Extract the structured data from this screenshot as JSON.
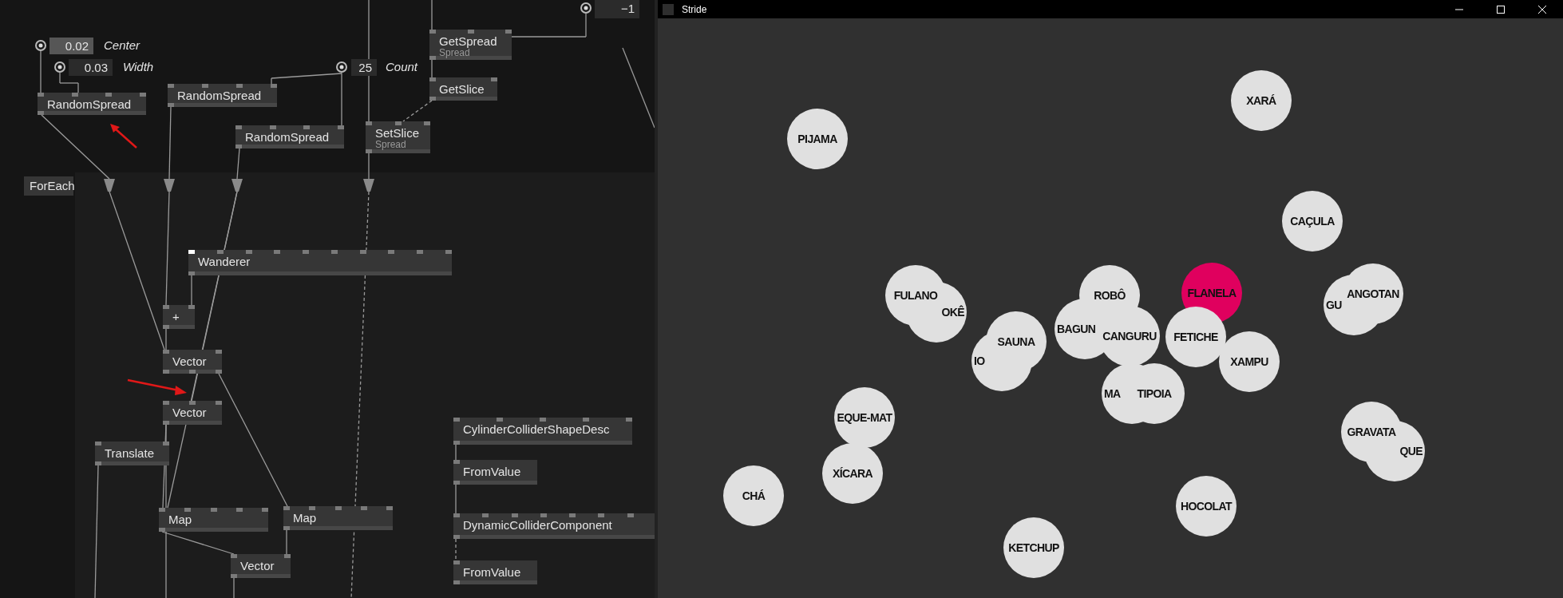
{
  "io_boxes": [
    {
      "value": "0.02",
      "label": "Center",
      "selected": true
    },
    {
      "value": "0.03",
      "label": "Width",
      "selected": false
    },
    {
      "value": "25",
      "label": "Count",
      "selected": false
    },
    {
      "value": "−1",
      "selected": false
    }
  ],
  "nodes": [
    {
      "title": "RandomSpread"
    },
    {
      "title": "RandomSpread"
    },
    {
      "title": "RandomSpread"
    },
    {
      "title": "GetSpread",
      "subtitle": "Spread"
    },
    {
      "title": "GetSlice"
    },
    {
      "title": "SetSlice",
      "subtitle": "Spread"
    },
    {
      "title": "ForEach"
    },
    {
      "title": "Wanderer"
    },
    {
      "title": "+"
    },
    {
      "title": "Vector"
    },
    {
      "title": "Vector"
    },
    {
      "title": "Translate"
    },
    {
      "title": "Map"
    },
    {
      "title": "Map"
    },
    {
      "title": "Vector"
    },
    {
      "title": "CylinderColliderShapeDesc"
    },
    {
      "title": "FromValue"
    },
    {
      "title": "DynamicColliderComponent"
    },
    {
      "title": "FromValue"
    }
  ],
  "window": {
    "title": "Stride"
  },
  "balls": [
    {
      "label": "XARÁ",
      "color": "#e0e0e0"
    },
    {
      "label": "PIJAMA",
      "color": "#e0e0e0"
    },
    {
      "label": "CAÇULA",
      "color": "#e0e0e0"
    },
    {
      "label": "GU",
      "color": "#e0e0e0"
    },
    {
      "label": "ANGOTAN",
      "color": "#e0e0e0"
    },
    {
      "label": "OKÊ",
      "color": "#e0e0e0"
    },
    {
      "label": "FULANO",
      "color": "#e0e0e0"
    },
    {
      "label": "ROBÔ",
      "color": "#e0e0e0"
    },
    {
      "label": "FLANELA",
      "color": "#e0005e"
    },
    {
      "label": "BAGUN",
      "color": "#e0e0e0"
    },
    {
      "label": "CANGURU",
      "color": "#e0e0e0"
    },
    {
      "label": "FETICHE",
      "color": "#e0e0e0"
    },
    {
      "label": "XAMPU",
      "color": "#e0e0e0"
    },
    {
      "label": "IO",
      "color": "#e0e0e0"
    },
    {
      "label": "SAUNA",
      "color": "#e0e0e0"
    },
    {
      "label": "MA",
      "color": "#e0e0e0"
    },
    {
      "label": "TIPOIA",
      "color": "#e0e0e0"
    },
    {
      "label": "EQUE-MAT",
      "color": "#e0e0e0"
    },
    {
      "label": "XÍCARA",
      "color": "#e0e0e0"
    },
    {
      "label": "CHÁ",
      "color": "#e0e0e0"
    },
    {
      "label": "QUE",
      "color": "#e0e0e0"
    },
    {
      "label": "GRAVATA",
      "color": "#e0e0e0"
    },
    {
      "label": "HOCOLAT",
      "color": "#e0e0e0"
    },
    {
      "label": "KETCHUP",
      "color": "#e0e0e0"
    }
  ]
}
